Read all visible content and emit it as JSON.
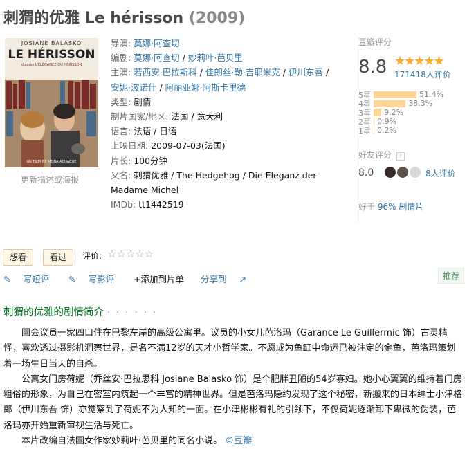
{
  "movie": {
    "title": "刺猬的优雅 Le hérisson",
    "year": "(2009)"
  },
  "poster": {
    "actress_name": "JOSIANE BALASKO",
    "film_name": "LE HÉRISSON",
    "tagline": "d'après L'ÉLÉGANCE DU HÉRISSON",
    "credit": "UN FILM DE MONA ACHACHE",
    "caption": "更新描述或海报"
  },
  "info": {
    "director_label": "导演",
    "director": "莫娜·阿查切",
    "writer_label": "编剧",
    "writers": [
      "莫娜·阿查切",
      "妙莉叶·芭贝里"
    ],
    "cast_label": "主演",
    "cast": [
      "若西安·巴拉斯科",
      "佳朗丝·勒·吉耶米克",
      "伊川东吾",
      "安妮·波诺什",
      "阿丽亚娜·阿斯卡里德"
    ],
    "genre_label": "类型:",
    "genre": "剧情",
    "country_label": "制片国家/地区:",
    "country": "法国 / 意大利",
    "language_label": "语言:",
    "language": "法语 / 日语",
    "release_label": "上映日期:",
    "release": "2009-07-03(法国)",
    "runtime_label": "片长:",
    "runtime": "100分钟",
    "aka_label": "又名:",
    "aka": "刺猬优雅 / The Hedgehog / Die Eleganz der Madame Michel",
    "imdb_label": "IMDb:",
    "imdb": "tt1442519"
  },
  "rating": {
    "section_title": "豆瓣评分",
    "score": "8.8",
    "stars": "★★★★★",
    "votes": "171418人评价",
    "distribution": [
      {
        "label": "5星",
        "percent": "51.4%",
        "value": 51.4
      },
      {
        "label": "4星",
        "percent": "38.3%",
        "value": 38.3
      },
      {
        "label": "3星",
        "percent": "9.2%",
        "value": 9.2
      },
      {
        "label": "2星",
        "percent": "0.9%",
        "value": 0.9
      },
      {
        "label": "1星",
        "percent": "0.2%",
        "value": 0.2
      }
    ],
    "friend_title": "好友评分",
    "friend_help": "?",
    "friend_score": "8.0",
    "friend_count": "8人评价",
    "better_prefix": "好于",
    "better_value": "96% 剧情片"
  },
  "buttons": {
    "want": "想看",
    "seen": "看过",
    "rate_label": "评价:",
    "empty_stars": "☆☆☆☆☆"
  },
  "actions": {
    "short_review": "写短评",
    "review": "写影评",
    "add_list": "+添加到片单",
    "share": "分享到",
    "recommend": "推荐"
  },
  "summary": {
    "title": "刺猬的优雅的剧情简介",
    "dots": "· · · · · ·",
    "p1": "国会议员一家四口住在巴黎左岸的高级公寓里。议员的小女儿芭洛玛（Garance Le Guillermic 饰）古灵精怪，喜欢透过摄影机洞察世界，是名不满12岁的天才小哲学家。不愿成为鱼缸中命运已被注定的金鱼，芭洛玛策划着一场生日当天的自杀。",
    "p2": "公寓女门房荷妮（乔丝安·巴拉思科 Josiane Balasko 饰）是个肥胖丑陋的54岁寡妇。她小心翼翼的维持着门房粗俗的形象，为自己在密室内筑起一个丰富的精神世界。但是芭洛玛隐约发现了这个秘密，新搬来的日本绅士小津格郎（伊川东吾 饰）亦觉察到了荷妮不为人知的一面。在小津彬彬有礼的引领下，不仅荷妮逐渐卸下卑微的伪装，芭洛玛亦开始重新审视生活与死亡。",
    "p3": "本片改编自法国女作家妙莉叶·芭贝里的同名小说。",
    "source": "©豆瓣"
  },
  "colors": {
    "link": "#3377aa",
    "star": "#ffac2d",
    "bar": "#ffd596",
    "section": "#007722"
  }
}
